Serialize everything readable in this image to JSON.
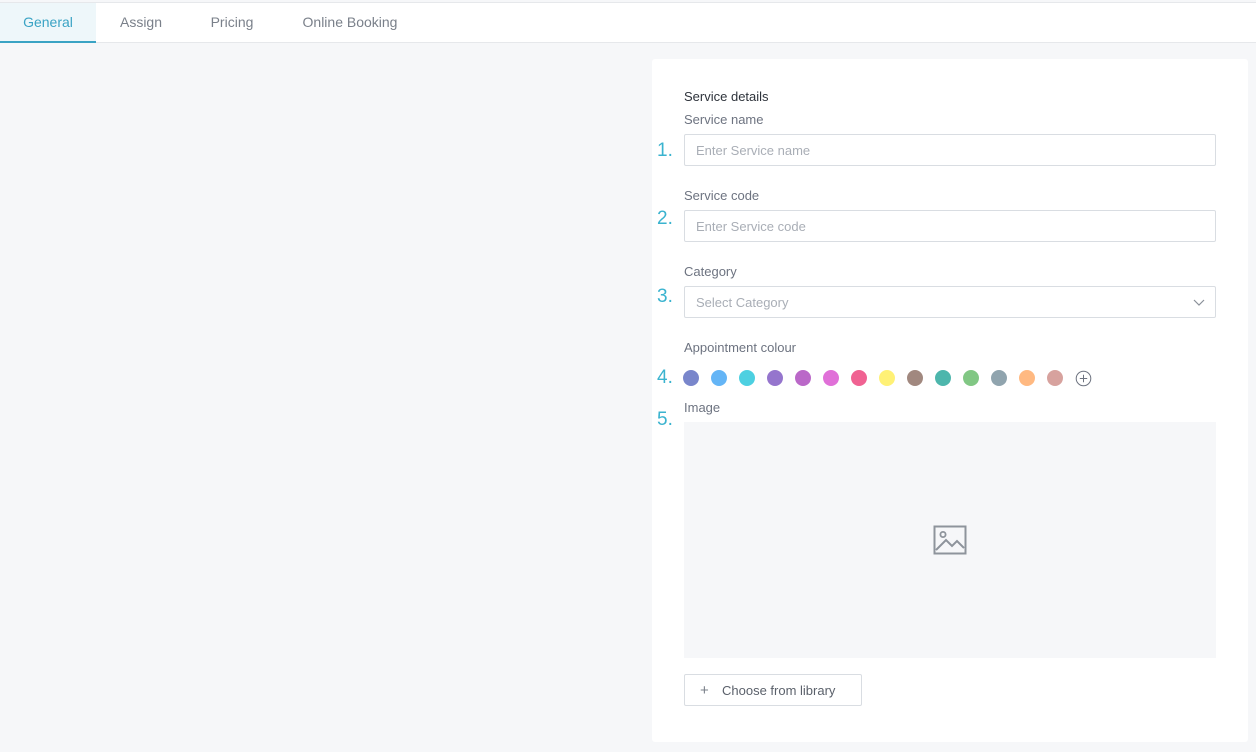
{
  "tabs": [
    {
      "label": "General",
      "active": true
    },
    {
      "label": "Assign",
      "active": false
    },
    {
      "label": "Pricing",
      "active": false
    },
    {
      "label": "Online Booking",
      "active": false
    }
  ],
  "form": {
    "section_title": "Service details",
    "numbers": [
      "1.",
      "2.",
      "3.",
      "4.",
      "5."
    ],
    "service_name": {
      "label": "Service name",
      "placeholder": "Enter Service name",
      "value": ""
    },
    "service_code": {
      "label": "Service code",
      "placeholder": "Enter Service code",
      "value": ""
    },
    "category": {
      "label": "Category",
      "placeholder": "Select Category"
    },
    "appointment_colour": {
      "label": "Appointment colour",
      "colors": [
        "#7986cb",
        "#64b5f6",
        "#4dd0e1",
        "#9575cd",
        "#ba68c8",
        "#e070d8",
        "#f06292",
        "#fff176",
        "#a1887f",
        "#4db6ac",
        "#81c784",
        "#90a4ae",
        "#ffb981",
        "#d7a29e"
      ]
    },
    "image": {
      "label": "Image"
    },
    "choose_library_label": "Choose from library"
  },
  "colors": {
    "accent": "#3aa3c4",
    "number_color": "#3ab3cf",
    "page_bg": "#f6f7f9"
  }
}
